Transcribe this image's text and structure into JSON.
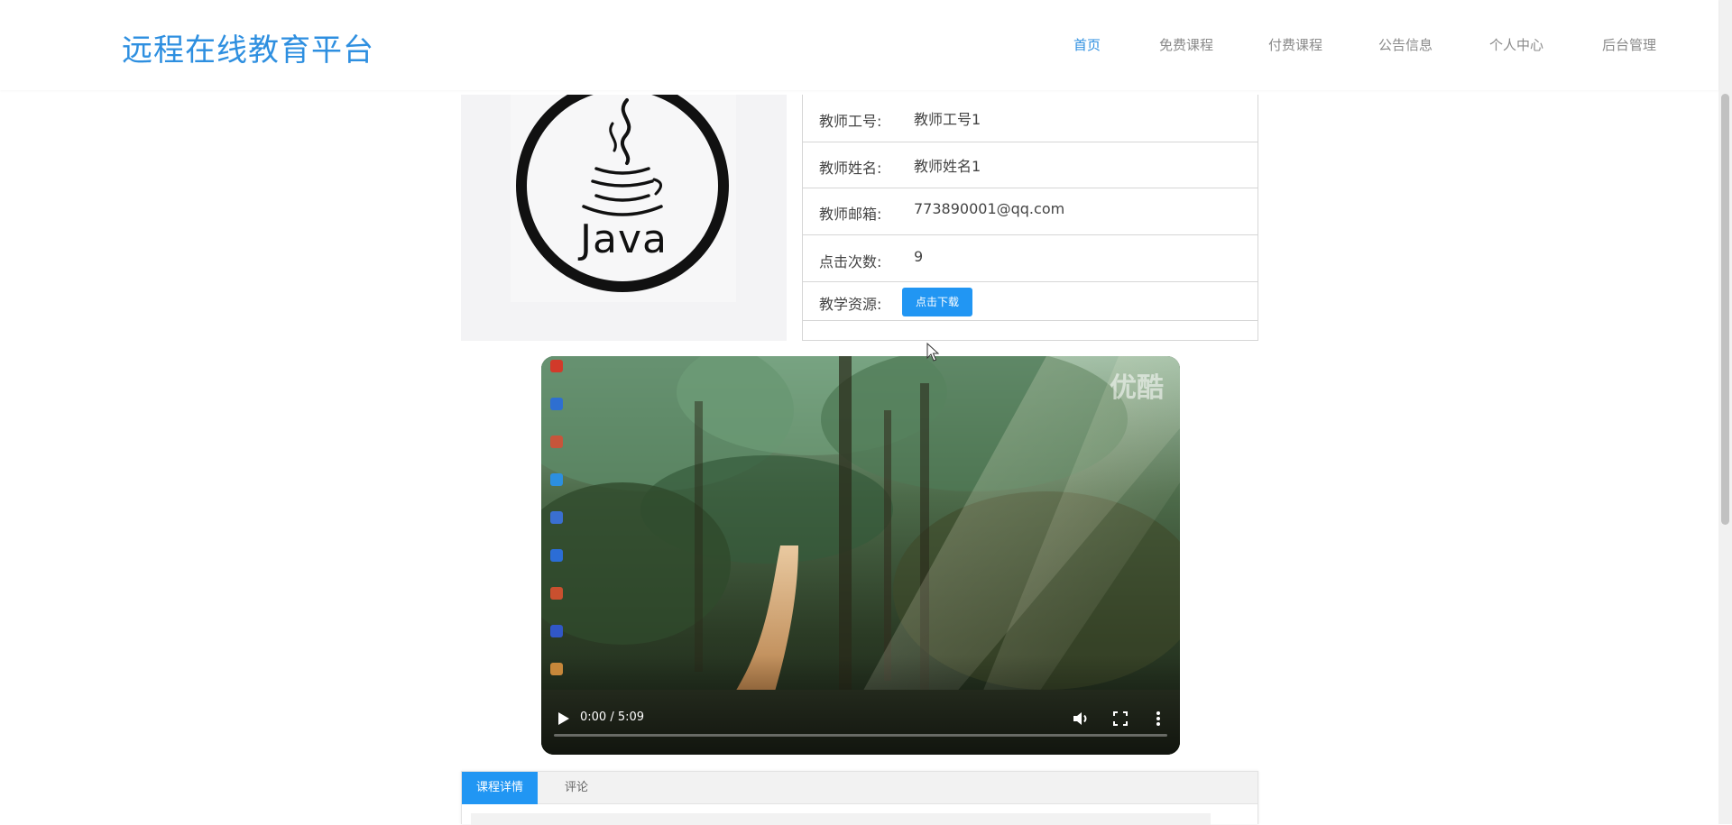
{
  "header": {
    "brand": "远程在线教育平台",
    "nav": [
      {
        "label": "首页",
        "active": true
      },
      {
        "label": "免费课程",
        "active": false
      },
      {
        "label": "付费课程",
        "active": false
      },
      {
        "label": "公告信息",
        "active": false
      },
      {
        "label": "个人中心",
        "active": false
      },
      {
        "label": "后台管理",
        "active": false
      }
    ]
  },
  "course_image": {
    "alt_text": "Java"
  },
  "teacher_info": {
    "rows": [
      {
        "label": "教师工号:",
        "value": "教师工号1"
      },
      {
        "label": "教师姓名:",
        "value": "教师姓名1"
      },
      {
        "label": "教师邮箱:",
        "value": "773890001@qq.com"
      },
      {
        "label": "点击次数:",
        "value": "9"
      },
      {
        "label": "教学资源:",
        "value": ""
      }
    ],
    "download_label": "点击下载"
  },
  "video": {
    "time": "0:00 / 5:09",
    "watermark": "优酷",
    "progress": 0
  },
  "tabs": {
    "items": [
      {
        "label": "课程详情",
        "active": true
      },
      {
        "label": "评论",
        "active": false
      }
    ]
  },
  "colors": {
    "accent": "#2e8fe0",
    "button": "#2196f3"
  }
}
